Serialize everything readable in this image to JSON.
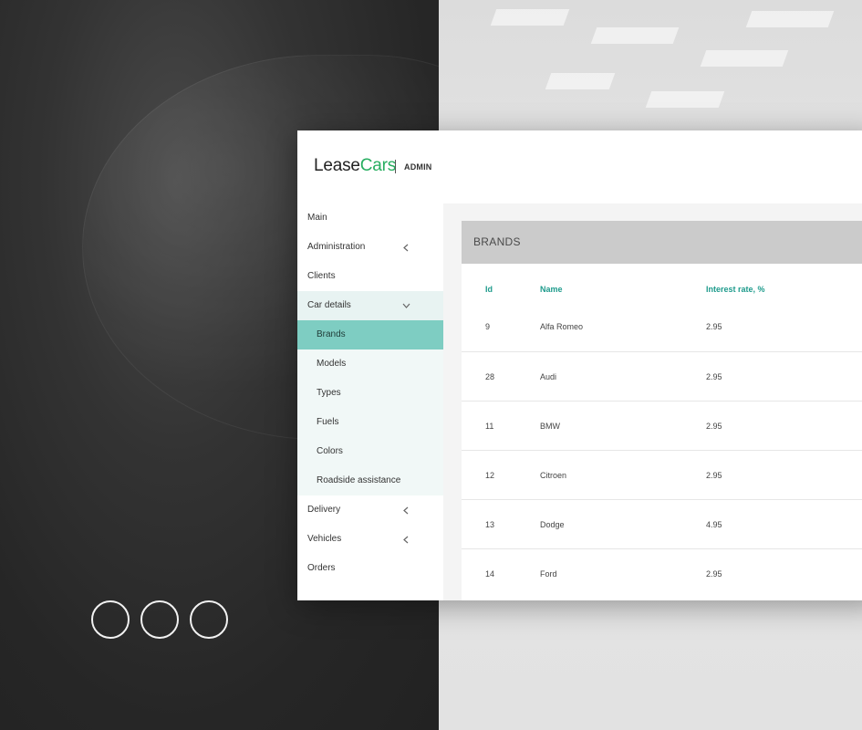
{
  "logo": {
    "lease": "Lease",
    "cars": "Cars",
    "admin": "ADMIN"
  },
  "colors": {
    "accent": "#27ae60",
    "active": "#7ecdc2",
    "table_header": "#1e9b8c"
  },
  "sidebar": {
    "items": [
      {
        "label": "Main"
      },
      {
        "label": "Administration",
        "icon": "chevron-left-icon"
      },
      {
        "label": "Clients"
      },
      {
        "label": "Car details",
        "icon": "chevron-down-icon"
      },
      {
        "label": "Delivery",
        "icon": "chevron-left-icon"
      },
      {
        "label": "Vehicles",
        "icon": "chevron-left-icon"
      },
      {
        "label": "Orders"
      }
    ],
    "car_details_sub": [
      {
        "label": "Brands"
      },
      {
        "label": "Models"
      },
      {
        "label": "Types"
      },
      {
        "label": "Fuels"
      },
      {
        "label": "Colors"
      },
      {
        "label": "Roadside assistance"
      }
    ]
  },
  "panel": {
    "title": "BRANDS",
    "columns": [
      "Id",
      "Name",
      "Interest rate, %"
    ],
    "rows": [
      [
        "9",
        "Alfa Romeo",
        "2.95"
      ],
      [
        "28",
        "Audi",
        "2.95"
      ],
      [
        "11",
        "BMW",
        "2.95"
      ],
      [
        "12",
        "Citroen",
        "2.95"
      ],
      [
        "13",
        "Dodge",
        "4.95"
      ],
      [
        "14",
        "Ford",
        "2.95"
      ]
    ]
  }
}
